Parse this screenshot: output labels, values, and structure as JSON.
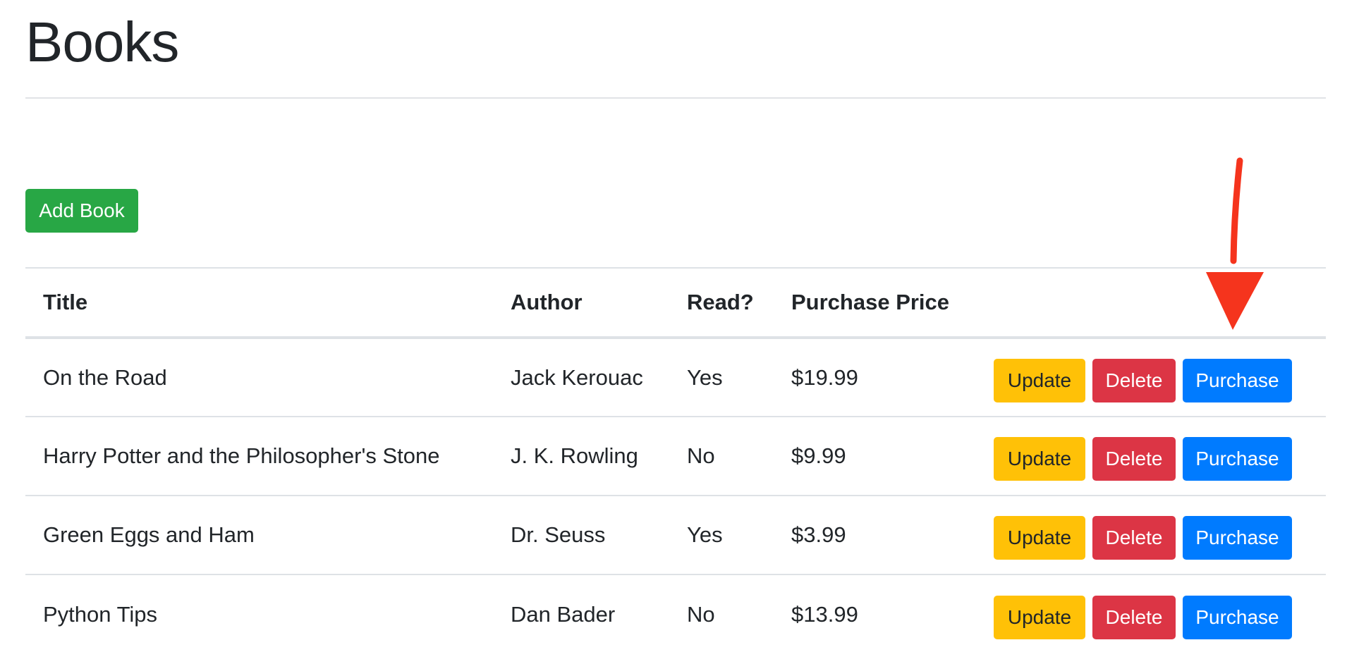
{
  "header": {
    "title": "Books"
  },
  "toolbar": {
    "add_book_label": "Add Book"
  },
  "table": {
    "columns": [
      "Title",
      "Author",
      "Read?",
      "Purchase Price",
      ""
    ],
    "rows": [
      {
        "title": "On the Road",
        "author": "Jack Kerouac",
        "read": "Yes",
        "price": "$19.99"
      },
      {
        "title": "Harry Potter and the Philosopher's Stone",
        "author": "J. K. Rowling",
        "read": "No",
        "price": "$9.99"
      },
      {
        "title": "Green Eggs and Ham",
        "author": "Dr. Seuss",
        "read": "Yes",
        "price": "$3.99"
      },
      {
        "title": "Python Tips",
        "author": "Dan Bader",
        "read": "No",
        "price": "$13.99"
      }
    ],
    "actions": {
      "update_label": "Update",
      "delete_label": "Delete",
      "purchase_label": "Purchase"
    }
  },
  "annotation": {
    "icon": "arrow-down-icon",
    "color": "#f5341d"
  },
  "colors": {
    "success": "#28a745",
    "warning": "#ffc107",
    "danger": "#dc3545",
    "primary": "#007bff",
    "text": "#212529",
    "border": "#dee2e6"
  }
}
